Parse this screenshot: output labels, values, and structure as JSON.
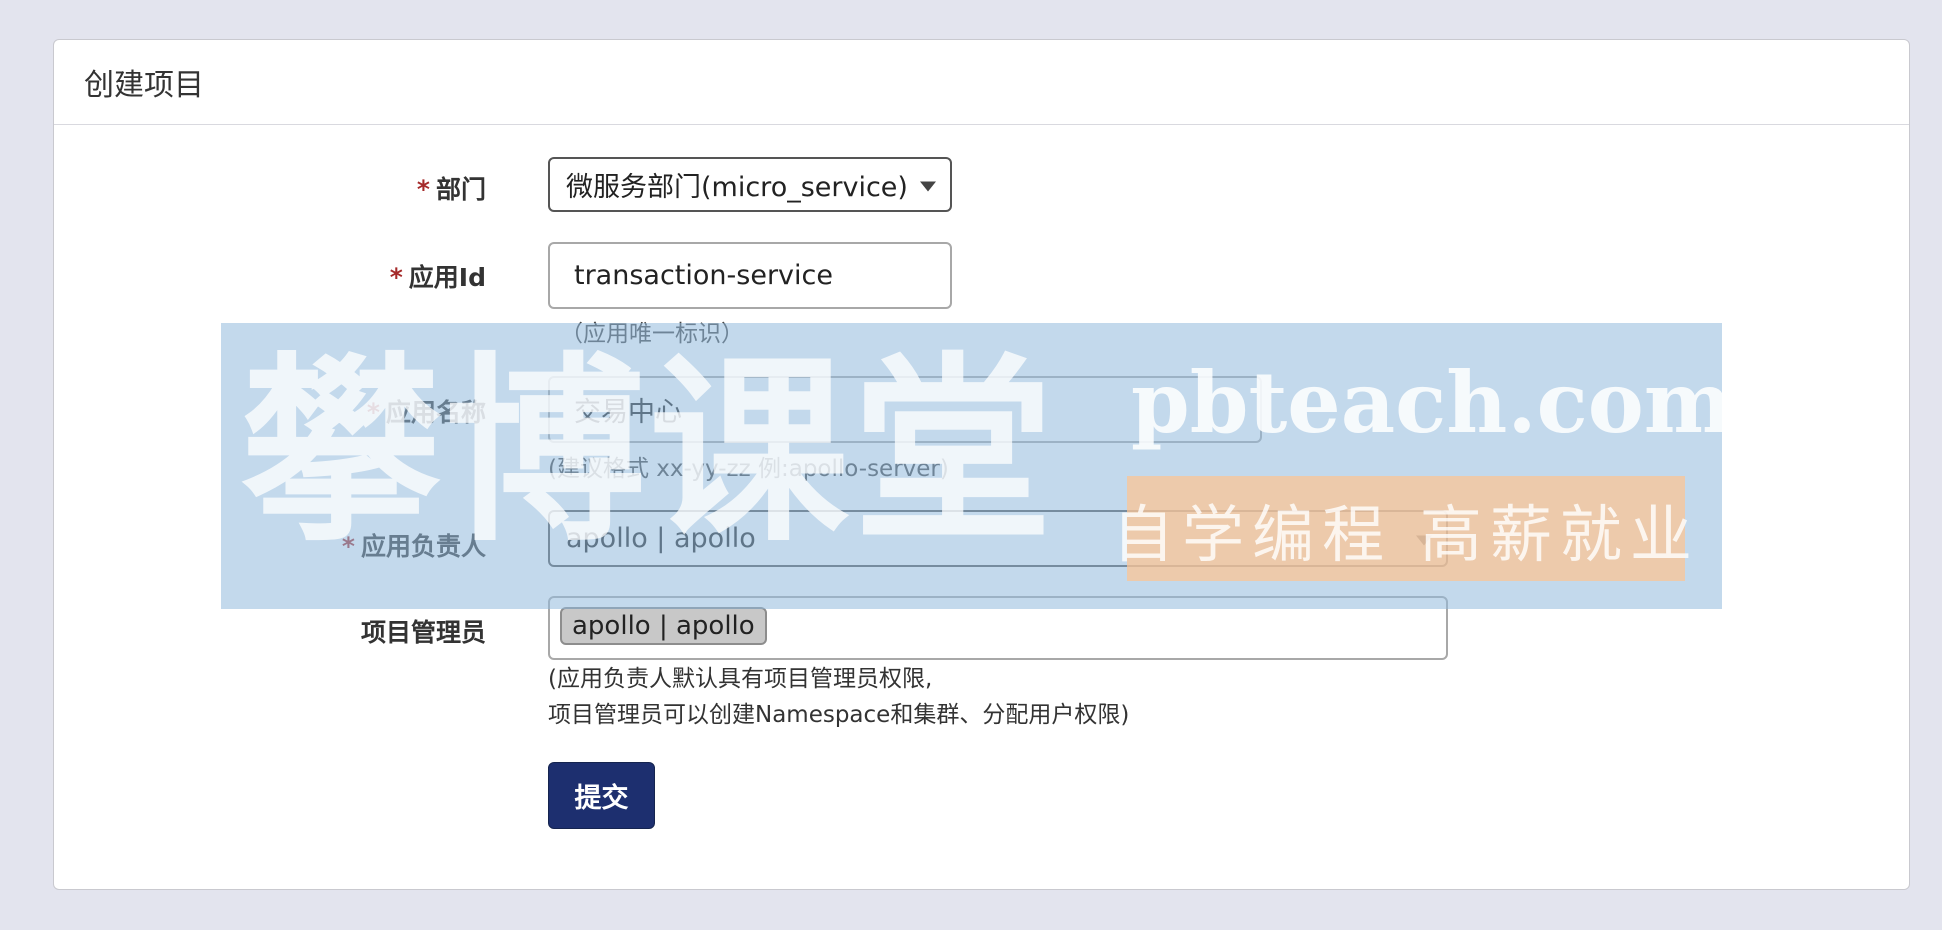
{
  "panel": {
    "title": "创建项目"
  },
  "form": {
    "required_mark": "*",
    "department": {
      "label": "部门",
      "value": "微服务部门(micro_service)"
    },
    "app_id": {
      "label": "应用Id",
      "value": "transaction-service",
      "help": "（应用唯一标识）"
    },
    "app_name": {
      "label": "应用名称",
      "value": "交易中心",
      "help": "(建议格式 xx-yy-zz 例:apollo-server)"
    },
    "owner": {
      "label": "应用负责人",
      "value": "apollo | apollo"
    },
    "admins": {
      "label": "项目管理员",
      "tags": [
        "apollo | apollo"
      ],
      "help_line1": "(应用负责人默认具有项目管理员权限,",
      "help_line2": "项目管理员可以创建Namespace和集群、分配用户权限)"
    },
    "submit_label": "提交"
  },
  "watermark": {
    "cn_text": "攀博课堂",
    "domain_text": "pbteach.com",
    "slogan": "自学编程 高薪就业"
  },
  "colors": {
    "background": "#e3e4ee",
    "submit_bg": "#1d2f6f",
    "required": "#a52a2a"
  }
}
